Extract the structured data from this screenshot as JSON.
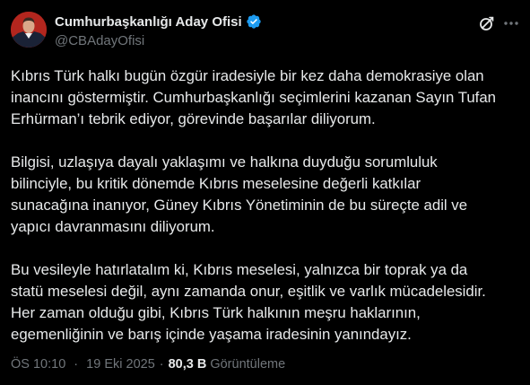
{
  "author": {
    "display_name": "Cumhurbaşkanlığı Aday Ofisi",
    "handle": "@CBAdayOfisi",
    "verified": true
  },
  "actions": {
    "grok_icon": "grok-icon",
    "more_icon": "more-icon"
  },
  "colors": {
    "background": "#000000",
    "text": "#e7e9ea",
    "muted": "#71767b",
    "verified": "#1d9bf0"
  },
  "tweet": {
    "paragraphs": [
      [
        "Kıbrıs Türk halkı bugün özgür iradesiyle bir kez daha demokrasiye olan",
        "inancını göstermiştir. Cumhurbaşkanlığı seçimlerini kazanan Sayın Tufan",
        "Erhürman’ı tebrik ediyor, görevinde başarılar diliyorum."
      ],
      [
        "Bilgisi, uzlaşıya dayalı yaklaşımı ve halkına duyduğu sorumluluk",
        "bilinciyle, bu kritik dönemde Kıbrıs meselesine değerli katkılar",
        "sunacağına inanıyor, Güney Kıbrıs Yönetiminin de bu süreçte adil ve",
        "yapıcı davranmasını diliyorum."
      ],
      [
        "Bu vesileyle hatırlatalım ki, Kıbrıs meselesi, yalnızca bir toprak ya da",
        "statü meselesi değil, aynı zamanda onur, eşitlik ve varlık mücadelesidir.",
        "Her zaman olduğu gibi, Kıbrıs Türk halkının meşru haklarının,",
        "egemenliğinin ve barış içinde yaşama iradesinin yanındayız."
      ]
    ],
    "time": "ÖS 10:10",
    "separator": "·",
    "date": "19 Eki 2025",
    "views_count": "80,3 B",
    "views_label": "Görüntüleme"
  }
}
